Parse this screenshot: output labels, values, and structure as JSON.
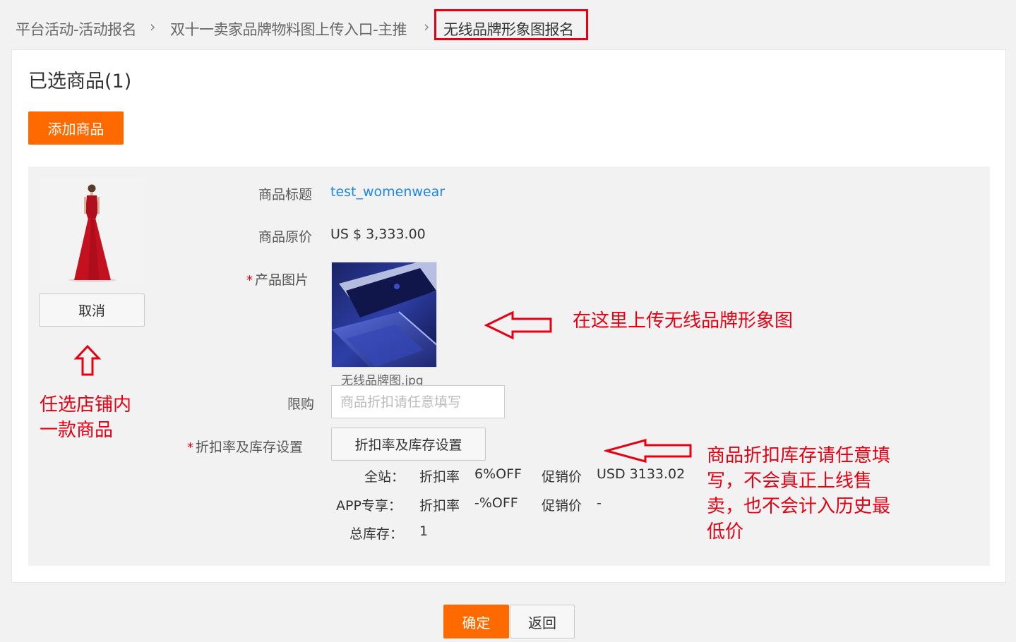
{
  "breadcrumb": {
    "items": [
      "平台活动-活动报名",
      "双十一卖家品牌物料图上传入口-主推",
      "无线品牌形象图报名"
    ]
  },
  "section": {
    "title": "已选商品(1)",
    "add_button": "添加商品"
  },
  "product": {
    "cancel_button": "取消",
    "title_label": "商品标题",
    "title_value": "test_womenwear",
    "price_label": "商品原价",
    "price_value": "US $ 3,333.00",
    "required_mark": "*",
    "image_label": "产品图片",
    "image_filename": "无线品牌图.jpg",
    "limit_label": "限购",
    "limit_placeholder": "商品折扣请任意填写",
    "discount_label": "折扣率及库存设置",
    "discount_button": "折扣率及库存设置",
    "rows": [
      {
        "scope": "全站：",
        "rate_label": "折扣率",
        "rate": "6%OFF",
        "promo_label": "促销价",
        "promo": "USD 3133.02"
      },
      {
        "scope": "APP专享：",
        "rate_label": "折扣率",
        "rate": "-%OFF",
        "promo_label": "促销价",
        "promo": "-"
      }
    ],
    "stock_label": "总库存：",
    "stock_value": "1"
  },
  "annotations": {
    "upload_note": "在这里上传无线品牌形象图",
    "select_note_line1": "任选店铺内",
    "select_note_line2": "一款商品",
    "discount_note_line1": "商品折扣库存请任意填",
    "discount_note_line2": "写，不会真正上线售",
    "discount_note_line3": "卖，也不会计入历史最",
    "discount_note_line4": "低价"
  },
  "footer": {
    "confirm_button": "确定",
    "back_button": "返回"
  },
  "colors": {
    "accent": "#ff6a00",
    "annotation": "#e60012",
    "link": "#1e88e5"
  }
}
